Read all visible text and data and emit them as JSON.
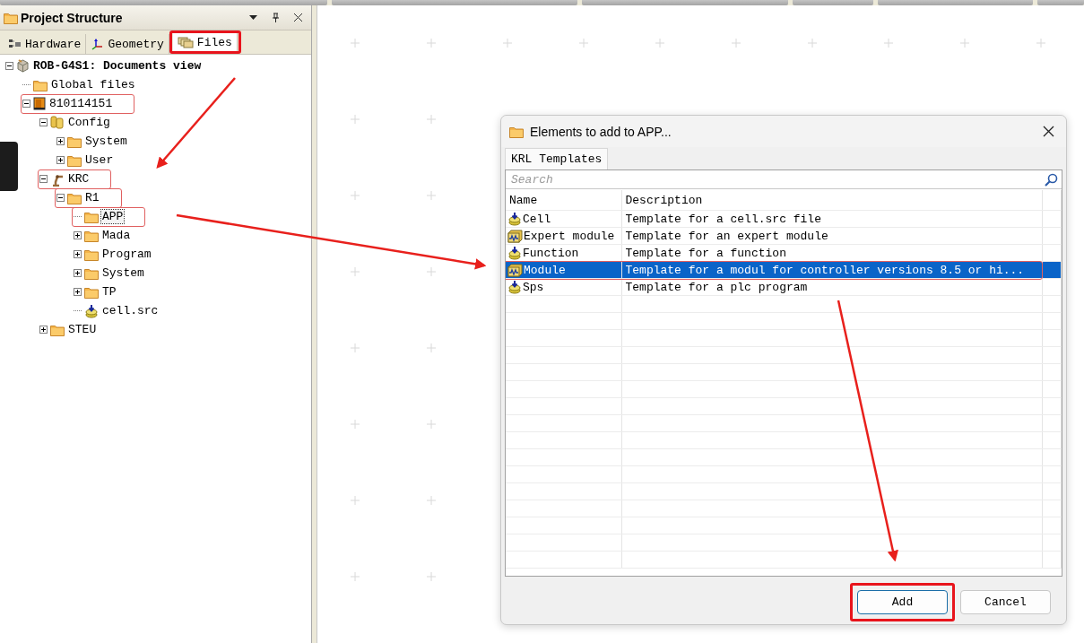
{
  "project_panel": {
    "title": "Project Structure",
    "tabs": [
      {
        "label": "Hardware",
        "selected": false,
        "highlighted": false
      },
      {
        "label": "Geometry",
        "selected": false,
        "highlighted": false
      },
      {
        "label": "Files",
        "selected": true,
        "highlighted": true
      }
    ],
    "tree": [
      {
        "label": "ROB-G4S1: Documents view",
        "kind": "project",
        "expanded": true,
        "selected": false,
        "highlighted": false,
        "children": [
          {
            "label": "Global files",
            "kind": "folder",
            "selected": false,
            "highlighted": false
          },
          {
            "label": "810114151",
            "kind": "controller",
            "expanded": true,
            "selected": false,
            "highlighted": true,
            "children": [
              {
                "label": "Config",
                "kind": "config",
                "expanded": true,
                "selected": false,
                "highlighted": false,
                "children": [
                  {
                    "label": "System",
                    "kind": "folder",
                    "expanded": false,
                    "selected": false,
                    "highlighted": false
                  },
                  {
                    "label": "User",
                    "kind": "folder",
                    "expanded": false,
                    "selected": false,
                    "highlighted": false
                  }
                ]
              },
              {
                "label": "KRC",
                "kind": "robot",
                "expanded": true,
                "selected": false,
                "highlighted": true,
                "children": [
                  {
                    "label": "R1",
                    "kind": "folder",
                    "expanded": true,
                    "selected": false,
                    "highlighted": true,
                    "children": [
                      {
                        "label": "APP",
                        "kind": "folder",
                        "selected": true,
                        "highlighted": true
                      },
                      {
                        "label": "Mada",
                        "kind": "folder",
                        "expanded": false,
                        "selected": false,
                        "highlighted": false
                      },
                      {
                        "label": "Program",
                        "kind": "folder",
                        "expanded": false,
                        "selected": false,
                        "highlighted": false
                      },
                      {
                        "label": "System",
                        "kind": "folder",
                        "expanded": false,
                        "selected": false,
                        "highlighted": false
                      },
                      {
                        "label": "TP",
                        "kind": "folder",
                        "expanded": false,
                        "selected": false,
                        "highlighted": false
                      },
                      {
                        "label": "cell.src",
                        "kind": "src",
                        "selected": false,
                        "highlighted": false
                      }
                    ]
                  }
                ]
              },
              {
                "label": "STEU",
                "kind": "folder",
                "expanded": false,
                "selected": false,
                "highlighted": false
              }
            ]
          }
        ]
      }
    ]
  },
  "dialog": {
    "title": "Elements to add to APP...",
    "tabs": [
      {
        "label": "KRL Templates",
        "selected": true
      }
    ],
    "search": {
      "placeholder": "Search"
    },
    "columns": [
      "Name",
      "Description"
    ],
    "rows": [
      {
        "name": "Cell",
        "description": "Template for a cell.src file",
        "kind": "src",
        "selected": false,
        "highlighted": false
      },
      {
        "name": "Expert module",
        "description": "Template for an expert module",
        "kind": "module",
        "selected": false,
        "highlighted": false
      },
      {
        "name": "Function",
        "description": "Template for a function",
        "kind": "src",
        "selected": false,
        "highlighted": false
      },
      {
        "name": "Module",
        "description": "Template for a modul for controller versions 8.5 or hi...",
        "kind": "module",
        "selected": true,
        "highlighted": true
      },
      {
        "name": "Sps",
        "description": "Template for a plc program",
        "kind": "src",
        "selected": false,
        "highlighted": false
      }
    ],
    "buttons": [
      {
        "label": "Add",
        "default": true,
        "highlighted": true
      },
      {
        "label": "Cancel",
        "default": false,
        "highlighted": false
      }
    ]
  }
}
